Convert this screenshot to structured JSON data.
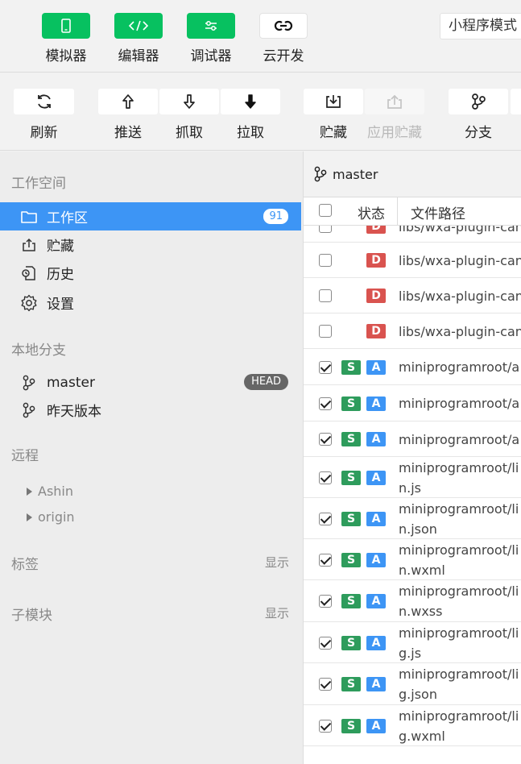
{
  "topbar": {
    "buttons": [
      {
        "label": "模拟器",
        "icon": "phone-icon",
        "style": "green"
      },
      {
        "label": "编辑器",
        "icon": "code-icon",
        "style": "green"
      },
      {
        "label": "调试器",
        "icon": "sliders-icon",
        "style": "green"
      },
      {
        "label": "云开发",
        "icon": "cloud-link-icon",
        "style": "white"
      }
    ],
    "mode": "小程序模式"
  },
  "toolbar": {
    "buttons": [
      {
        "label": "刷新",
        "icon": "refresh-icon",
        "enabled": true
      },
      {
        "label": "推送",
        "icon": "push-icon",
        "enabled": true
      },
      {
        "label": "抓取",
        "icon": "fetch-icon",
        "enabled": true
      },
      {
        "label": "拉取",
        "icon": "pull-icon",
        "enabled": true
      },
      {
        "label": "贮藏",
        "icon": "stash-icon",
        "enabled": true
      },
      {
        "label": "应用贮藏",
        "icon": "apply-stash-icon",
        "enabled": false
      },
      {
        "label": "分支",
        "icon": "branch-icon",
        "enabled": true
      }
    ]
  },
  "sidebar": {
    "workspace_title": "工作空间",
    "workspace_items": [
      {
        "label": "工作区",
        "icon": "folder-icon",
        "badge": "91",
        "active": true
      },
      {
        "label": "贮藏",
        "icon": "stash-icon",
        "active": false
      },
      {
        "label": "历史",
        "icon": "history-icon",
        "active": false
      },
      {
        "label": "设置",
        "icon": "gear-icon",
        "active": false
      }
    ],
    "local_title": "本地分支",
    "branches": [
      {
        "label": "master",
        "badge": "HEAD"
      },
      {
        "label": "昨天版本"
      }
    ],
    "remote_title": "远程",
    "remotes": [
      "Ashin",
      "origin"
    ],
    "tags_title": "标签",
    "tags_action": "显示",
    "submodules_title": "子模块",
    "submodules_action": "显示"
  },
  "panel": {
    "branch": "master",
    "col_status": "状态",
    "col_path": "文件路径",
    "rows": [
      {
        "checked": false,
        "staged": "",
        "status": "D",
        "lines": [
          "libs/wxa-plugin-can"
        ]
      },
      {
        "checked": false,
        "staged": "",
        "status": "D",
        "lines": [
          "libs/wxa-plugin-can"
        ]
      },
      {
        "checked": false,
        "staged": "",
        "status": "D",
        "lines": [
          "libs/wxa-plugin-can"
        ]
      },
      {
        "checked": false,
        "staged": "",
        "status": "D",
        "lines": [
          "libs/wxa-plugin-can"
        ]
      },
      {
        "checked": true,
        "staged": "S",
        "status": "A",
        "lines": [
          "miniprogramroot/a"
        ]
      },
      {
        "checked": true,
        "staged": "S",
        "status": "A",
        "lines": [
          "miniprogramroot/a"
        ]
      },
      {
        "checked": true,
        "staged": "S",
        "status": "A",
        "lines": [
          "miniprogramroot/a"
        ]
      },
      {
        "checked": true,
        "staged": "S",
        "status": "A",
        "lines": [
          "miniprogramroot/li",
          "n.js"
        ]
      },
      {
        "checked": true,
        "staged": "S",
        "status": "A",
        "lines": [
          "miniprogramroot/li",
          "n.json"
        ]
      },
      {
        "checked": true,
        "staged": "S",
        "status": "A",
        "lines": [
          "miniprogramroot/li",
          "n.wxml"
        ]
      },
      {
        "checked": true,
        "staged": "S",
        "status": "A",
        "lines": [
          "miniprogramroot/li",
          "n.wxss"
        ]
      },
      {
        "checked": true,
        "staged": "S",
        "status": "A",
        "lines": [
          "miniprogramroot/li",
          "g.js"
        ]
      },
      {
        "checked": true,
        "staged": "S",
        "status": "A",
        "lines": [
          "miniprogramroot/li",
          "g.json"
        ]
      },
      {
        "checked": true,
        "staged": "S",
        "status": "A",
        "lines": [
          "miniprogramroot/li",
          "g.wxml"
        ]
      }
    ]
  }
}
